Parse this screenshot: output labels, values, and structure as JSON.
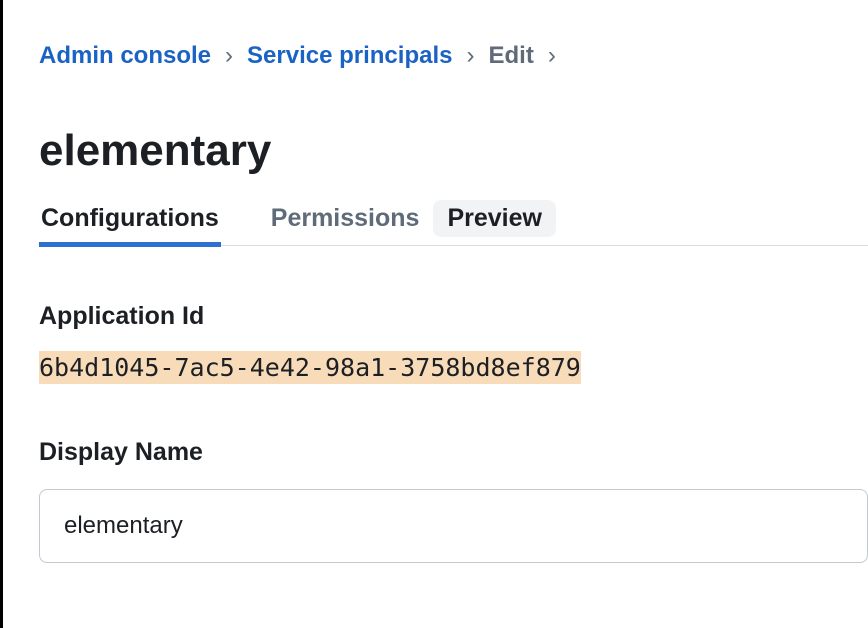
{
  "breadcrumb": {
    "items": [
      {
        "label": "Admin console",
        "type": "link"
      },
      {
        "label": "Service principals",
        "type": "link"
      },
      {
        "label": "Edit",
        "type": "current"
      }
    ],
    "separator": "›"
  },
  "page": {
    "title": "elementary"
  },
  "tabs": {
    "items": [
      {
        "label": "Configurations",
        "active": true
      },
      {
        "label": "Permissions",
        "active": false
      }
    ],
    "badge": "Preview"
  },
  "fields": {
    "application_id": {
      "label": "Application Id",
      "value": "6b4d1045-7ac5-4e42-98a1-3758bd8ef879"
    },
    "display_name": {
      "label": "Display Name",
      "value": "elementary"
    }
  }
}
